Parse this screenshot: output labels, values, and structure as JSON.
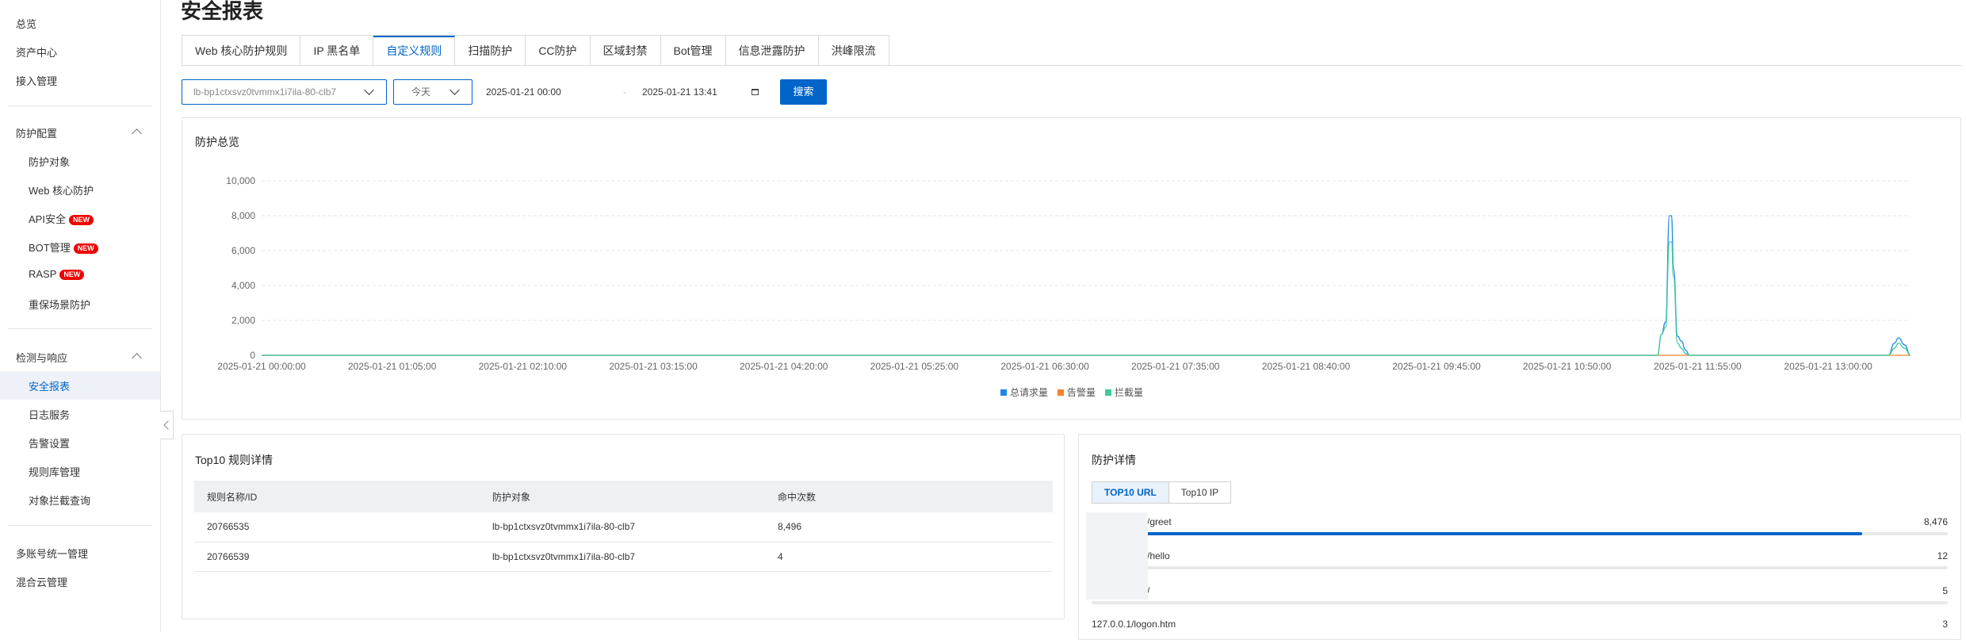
{
  "sidebar": {
    "items": [
      {
        "label": "总览"
      },
      {
        "label": "资产中心"
      },
      {
        "label": "接入管理"
      }
    ],
    "group1": {
      "label": "防护配置",
      "items": [
        {
          "label": "防护对象"
        },
        {
          "label": "Web 核心防护"
        },
        {
          "label": "API安全",
          "badge": "NEW"
        },
        {
          "label": "BOT管理",
          "badge": "NEW"
        },
        {
          "label": "RASP",
          "badge": "NEW"
        },
        {
          "label": "重保场景防护"
        }
      ]
    },
    "group2": {
      "label": "检测与响应",
      "items": [
        {
          "label": "安全报表"
        },
        {
          "label": "日志服务"
        },
        {
          "label": "告警设置"
        },
        {
          "label": "规则库管理"
        },
        {
          "label": "对象拦截查询"
        }
      ]
    },
    "bottom": [
      {
        "label": "多账号统一管理"
      },
      {
        "label": "混合云管理"
      }
    ]
  },
  "page": {
    "title": "安全报表"
  },
  "tabs": [
    "Web 核心防护规则",
    "IP 黑名单",
    "自定义规则",
    "扫描防护",
    "CC防护",
    "区域封禁",
    "Bot管理",
    "信息泄露防护",
    "洪峰限流"
  ],
  "filters": {
    "instance": "lb-bp1ctxsvz0tvmmx1i7ila-80-clb7",
    "period": "今天",
    "start": "2025-01-21 00:00",
    "separator": "-",
    "end": "2025-01-21 13:41",
    "search": "搜索"
  },
  "overview": {
    "title": "防护总览",
    "legend": [
      "总请求量",
      "告警量",
      "拦截量"
    ]
  },
  "colors": {
    "total": "#1e88e5",
    "alert": "#f5832a",
    "block": "#3ccb9a",
    "accent": "#0064c8"
  },
  "chart_data": {
    "type": "line",
    "ylim": [
      0,
      10000
    ],
    "yticks": [
      "0",
      "2,000",
      "4,000",
      "6,000",
      "8,000",
      "10,000"
    ],
    "xticks": [
      "2025-01-21 00:00:00",
      "2025-01-21 01:05:00",
      "2025-01-21 02:10:00",
      "2025-01-21 03:15:00",
      "2025-01-21 04:20:00",
      "2025-01-21 05:25:00",
      "2025-01-21 06:30:00",
      "2025-01-21 07:35:00",
      "2025-01-21 08:40:00",
      "2025-01-21 09:45:00",
      "2025-01-21 10:50:00",
      "2025-01-21 11:55:00",
      "2025-01-21 13:00:00"
    ],
    "x": [
      "00:00",
      "11:35",
      "11:37",
      "11:39",
      "11:41",
      "11:42",
      "11:43",
      "11:45",
      "11:47",
      "11:49",
      "11:51",
      "13:30",
      "13:33",
      "13:35",
      "13:38",
      "13:41"
    ],
    "grid": true,
    "legend_position": "bottom",
    "series": [
      {
        "name": "总请求量",
        "values": [
          0,
          0,
          1200,
          1900,
          8000,
          8000,
          5000,
          1100,
          800,
          300,
          0,
          0,
          700,
          1000,
          600,
          0
        ]
      },
      {
        "name": "告警量",
        "values": [
          0,
          0,
          0,
          0,
          0,
          0,
          0,
          0,
          0,
          0,
          0,
          0,
          0,
          0,
          0,
          0
        ]
      },
      {
        "name": "拦截量",
        "values": [
          0,
          0,
          1200,
          1600,
          6500,
          6500,
          4500,
          700,
          400,
          100,
          0,
          0,
          400,
          700,
          400,
          0
        ]
      }
    ]
  },
  "top10": {
    "title": "Top10 规则详情",
    "headers": [
      "规则名称/ID",
      "防护对象",
      "命中次数"
    ],
    "rows": [
      [
        "20766535",
        "lb-bp1ctxsvz0tvmmx1i7ila-80-clb7",
        "8,496"
      ],
      [
        "20766539",
        "lb-bp1ctxsvz0tvmmx1i7ila-80-clb7",
        "4"
      ]
    ]
  },
  "detail": {
    "title": "防护详情",
    "tabs": [
      "TOP10 URL",
      "Top10 IP"
    ],
    "urls": [
      {
        "label": "/greet",
        "count": "8,476",
        "fraction": 0.9
      },
      {
        "label": "/hello",
        "count": "12",
        "fraction": 0.0
      },
      {
        "label": "/",
        "count": "5",
        "fraction": 0.0
      },
      {
        "label": "127.0.0.1/logon.htm",
        "count": "3",
        "fraction": 0.0
      }
    ]
  }
}
